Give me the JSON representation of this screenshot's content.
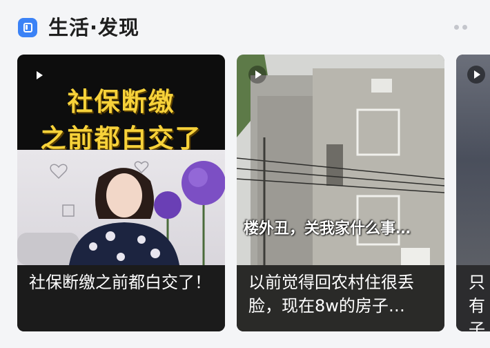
{
  "section": {
    "title": "生活·发现",
    "icon": "app-logo-icon",
    "more_icon": "more-dots-icon"
  },
  "cards": [
    {
      "headline_line1": "社保断缴",
      "headline_line2": "之前都白交了",
      "caption": "社保断缴之前都白交了！",
      "play_icon": "play-icon"
    },
    {
      "overlay_text": "楼外丑，关我家什么事…",
      "caption": "以前觉得回农村住很丢脸，现在8w的房子…",
      "play_icon": "play-icon"
    },
    {
      "caption": "只有子有",
      "play_icon": "play-icon"
    }
  ],
  "colors": {
    "accent": "#3b82f6",
    "headline_yellow": "#f7d23a",
    "card_caption_bg": "#1b1b1b"
  }
}
